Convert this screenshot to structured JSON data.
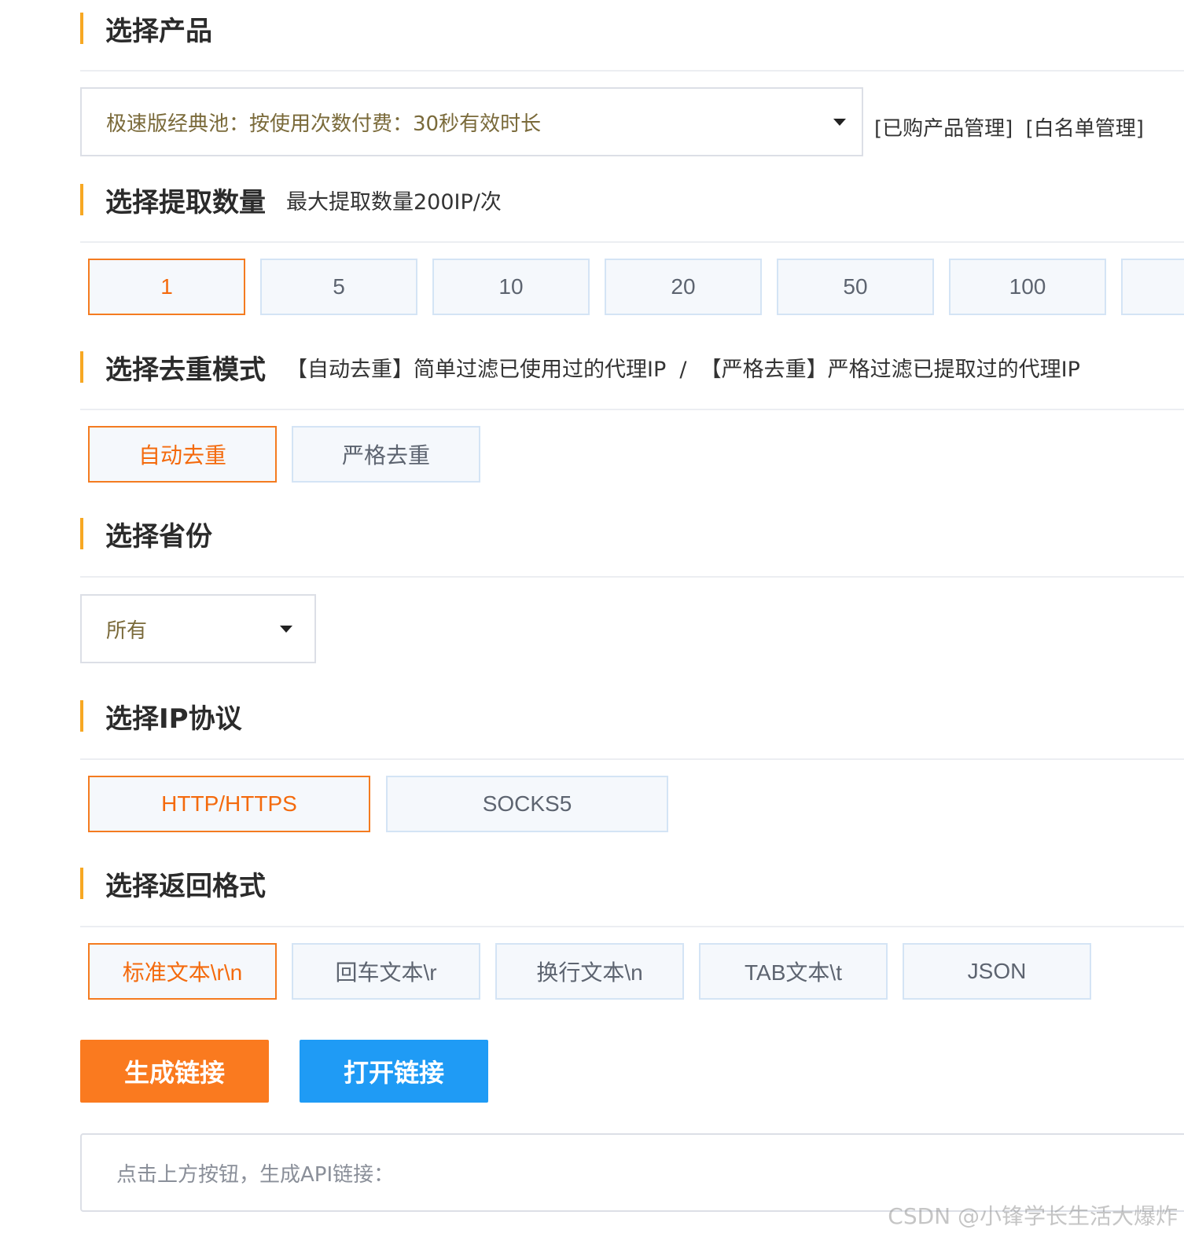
{
  "product": {
    "title": "选择产品",
    "selected": "极速版经典池：按使用次数付费：30秒有效时长",
    "links": [
      "[已购产品管理]",
      "[白名单管理]"
    ]
  },
  "quantity": {
    "title": "选择提取数量",
    "hint": "最大提取数量200IP/次",
    "options": [
      "1",
      "5",
      "10",
      "20",
      "50",
      "100"
    ],
    "selected": "1"
  },
  "dedup": {
    "title": "选择去重模式",
    "hint": "【自动去重】简单过滤已使用过的代理IP  /  【严格去重】严格过滤已提取过的代理IP",
    "options": [
      "自动去重",
      "严格去重"
    ],
    "selected": "自动去重"
  },
  "province": {
    "title": "选择省份",
    "selected": "所有"
  },
  "protocol": {
    "title": "选择IP协议",
    "options": [
      "HTTP/HTTPS",
      "SOCKS5"
    ],
    "selected": "HTTP/HTTPS"
  },
  "format": {
    "title": "选择返回格式",
    "options": [
      "标准文本\\r\\n",
      "回车文本\\r",
      "换行文本\\n",
      "TAB文本\\t",
      "JSON"
    ],
    "selected": "标准文本\\r\\n"
  },
  "actions": {
    "generate": "生成链接",
    "open": "打开链接"
  },
  "api_placeholder": "点击上方按钮，生成API链接：",
  "watermark": "CSDN @小锋学长生活大爆炸",
  "colors": {
    "accent_orange": "#fa7a1f",
    "accent_blue": "#1f9bf5",
    "section_bar": "#f7a823"
  }
}
